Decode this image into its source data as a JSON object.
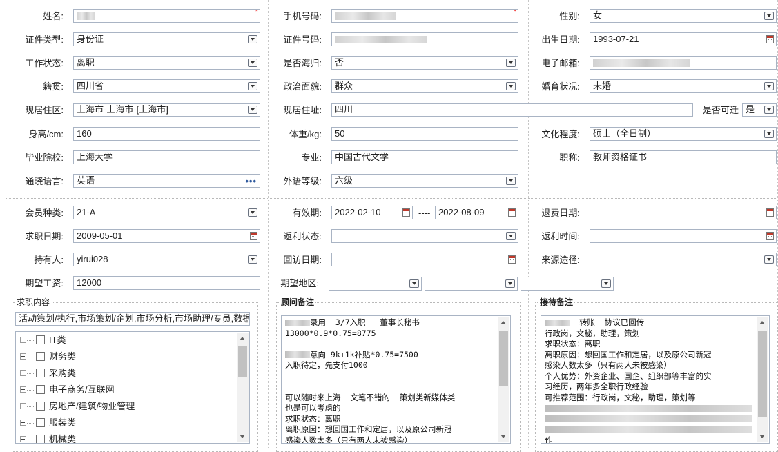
{
  "personal": {
    "name_label": "姓名:",
    "phone_label": "手机号码:",
    "gender_label": "性别:",
    "gender_value": "女",
    "id_type_label": "证件类型:",
    "id_type_value": "身份证",
    "id_no_label": "证件号码:",
    "birth_label": "出生日期:",
    "birth_value": "1993-07-21",
    "work_status_label": "工作状态:",
    "work_status_value": "离职",
    "overseas_label": "是否海归:",
    "overseas_value": "否",
    "email_label": "电子邮箱:",
    "origin_label": "籍贯:",
    "origin_value": "四川省",
    "political_label": "政治面貌:",
    "political_value": "群众",
    "marital_label": "婚育状况:",
    "marital_value": "未婚",
    "cur_area_label": "现居住区:",
    "cur_area_value": "上海市-上海市-[上海市]",
    "cur_addr_label": "现居住址:",
    "cur_addr_value": "四川",
    "relocate_label": "是否可迁",
    "relocate_value": "是",
    "height_label": "身高/cm:",
    "height_value": "160",
    "weight_label": "体重/kg:",
    "weight_value": "50",
    "edu_label": "文化程度:",
    "edu_value": "硕士（全日制）",
    "school_label": "毕业院校:",
    "school_value": "上海大学",
    "major_label": "专业:",
    "major_value": "中国古代文学",
    "title_label": "职称:",
    "title_value": "教师资格证书",
    "lang_label": "通晓语言:",
    "lang_value": "英语",
    "foreign_level_label": "外语等级:",
    "foreign_level_value": "六级"
  },
  "membership": {
    "member_type_label": "会员种类:",
    "member_type_value": "21-A",
    "valid_label": "有效期:",
    "valid_from": "2022-02-10",
    "valid_sep": "----",
    "valid_to": "2022-08-09",
    "refund_date_label": "退费日期:",
    "job_date_label": "求职日期:",
    "job_date_value": "2009-05-01",
    "rebate_status_label": "返利状态:",
    "rebate_time_label": "返利时间:",
    "holder_label": "持有人:",
    "holder_value": "yirui028",
    "revisit_label": "回访日期:",
    "source_label": "来源途径:",
    "salary_label": "期望工资:",
    "salary_value": "12000",
    "region_label": "期望地区:"
  },
  "job_content": {
    "title": "求职内容",
    "summary": "活动策划/执行,市场策划/企划,市场分析,市场助理/专员,数据",
    "tree": [
      "IT类",
      "财务类",
      "采购类",
      "电子商务/互联网",
      "房地产/建筑/物业管理",
      "服装类",
      "机械类"
    ]
  },
  "advisor_notes": {
    "title": "顾问备注",
    "lines": [
      {
        "blur": true,
        "text": "录用  3/7入职   董事长秘书"
      },
      {
        "blur": false,
        "text": "13000*0.9*0.75=8775"
      },
      {
        "blur": false,
        "text": ""
      },
      {
        "blur": true,
        "text": "意向 9k+1k补贴*0.75=7500"
      },
      {
        "blur": false,
        "text": "入职待定，先支付1000"
      },
      {
        "blur": false,
        "text": ""
      },
      {
        "blur": false,
        "text": ""
      },
      {
        "blur": false,
        "text": "可以随时来上海  文笔不错的  策划类新媒体类"
      },
      {
        "blur": false,
        "text": "也是可以考虑的"
      },
      {
        "blur": false,
        "text": "求职状态：离职"
      },
      {
        "blur": false,
        "text": "离职原因：想回国工作和定居，以及原公司新冠"
      },
      {
        "blur": false,
        "text": "感染人数太多（只有两人未被感染）"
      }
    ]
  },
  "reception_notes": {
    "title": "接待备注",
    "lines": [
      {
        "blur": true,
        "text": "  转账  协议已回传"
      },
      {
        "blur": false,
        "text": "行政岗，文秘，助理，策划"
      },
      {
        "blur": false,
        "text": "求职状态：离职"
      },
      {
        "blur": false,
        "text": "离职原因：想回国工作和定居，以及原公司新冠"
      },
      {
        "blur": false,
        "text": "感染人数太多（只有两人未被感染）"
      },
      {
        "blur": false,
        "text": "个人优势：外资企业、国企、组织部等丰富的实"
      },
      {
        "blur": false,
        "text": "习经历，两年多全职行政经验"
      },
      {
        "blur": false,
        "text": "可推荐范围：行政岗，文秘，助理，策划等"
      },
      {
        "blur": true,
        "text": ""
      },
      {
        "blur": true,
        "text": ""
      },
      {
        "blur": true,
        "text": ""
      },
      {
        "blur": false,
        "text": "作"
      }
    ]
  }
}
